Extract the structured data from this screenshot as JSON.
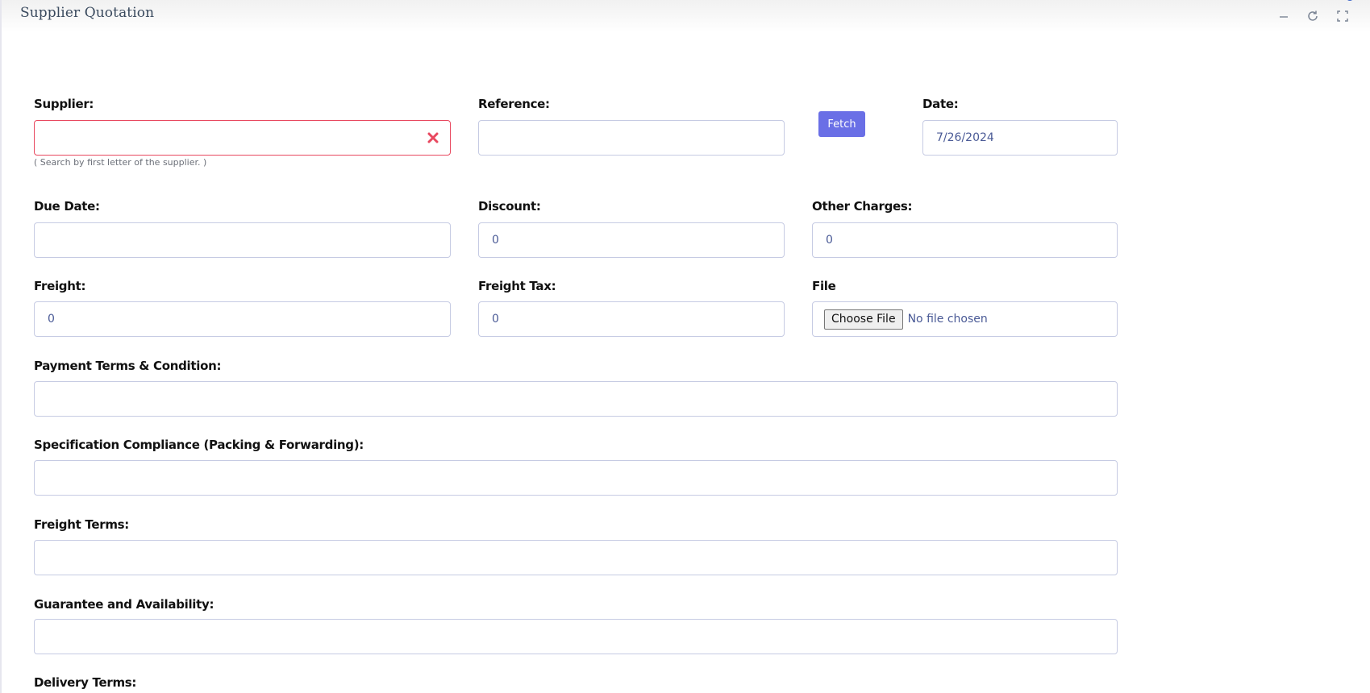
{
  "window": {
    "title": "Supplier Quotation",
    "controls": [
      "minimize-icon",
      "refresh-icon",
      "fullscreen-icon"
    ]
  },
  "colors": {
    "accent": "#6a6fe6",
    "error": "#e8485f",
    "input_border": "#c6cbe3",
    "value_text": "#4a5a96"
  },
  "form": {
    "supplier": {
      "label": "Supplier:",
      "value": "",
      "hint": "( Search by first letter of the supplier. )"
    },
    "reference": {
      "label": "Reference:",
      "value": ""
    },
    "fetch_button": "Fetch",
    "date": {
      "label": "Date:",
      "value": "7/26/2024"
    },
    "due_date": {
      "label": "Due Date:",
      "value": ""
    },
    "discount": {
      "label": "Discount:",
      "value": "0"
    },
    "other_charges": {
      "label": "Other Charges:",
      "value": "0"
    },
    "freight": {
      "label": "Freight:",
      "value": "0"
    },
    "freight_tax": {
      "label": "Freight Tax:",
      "value": "0"
    },
    "file": {
      "label": "File",
      "button": "Choose File",
      "status": "No file chosen"
    },
    "payment_terms": {
      "label": "Payment Terms & Condition:",
      "value": ""
    },
    "spec_compliance": {
      "label": "Specification Compliance (Packing & Forwarding):",
      "value": ""
    },
    "freight_terms": {
      "label": "Freight Terms:",
      "value": ""
    },
    "guarantee": {
      "label": "Guarantee and Availability:",
      "value": ""
    },
    "delivery_terms": {
      "label": "Delivery Terms:"
    }
  }
}
